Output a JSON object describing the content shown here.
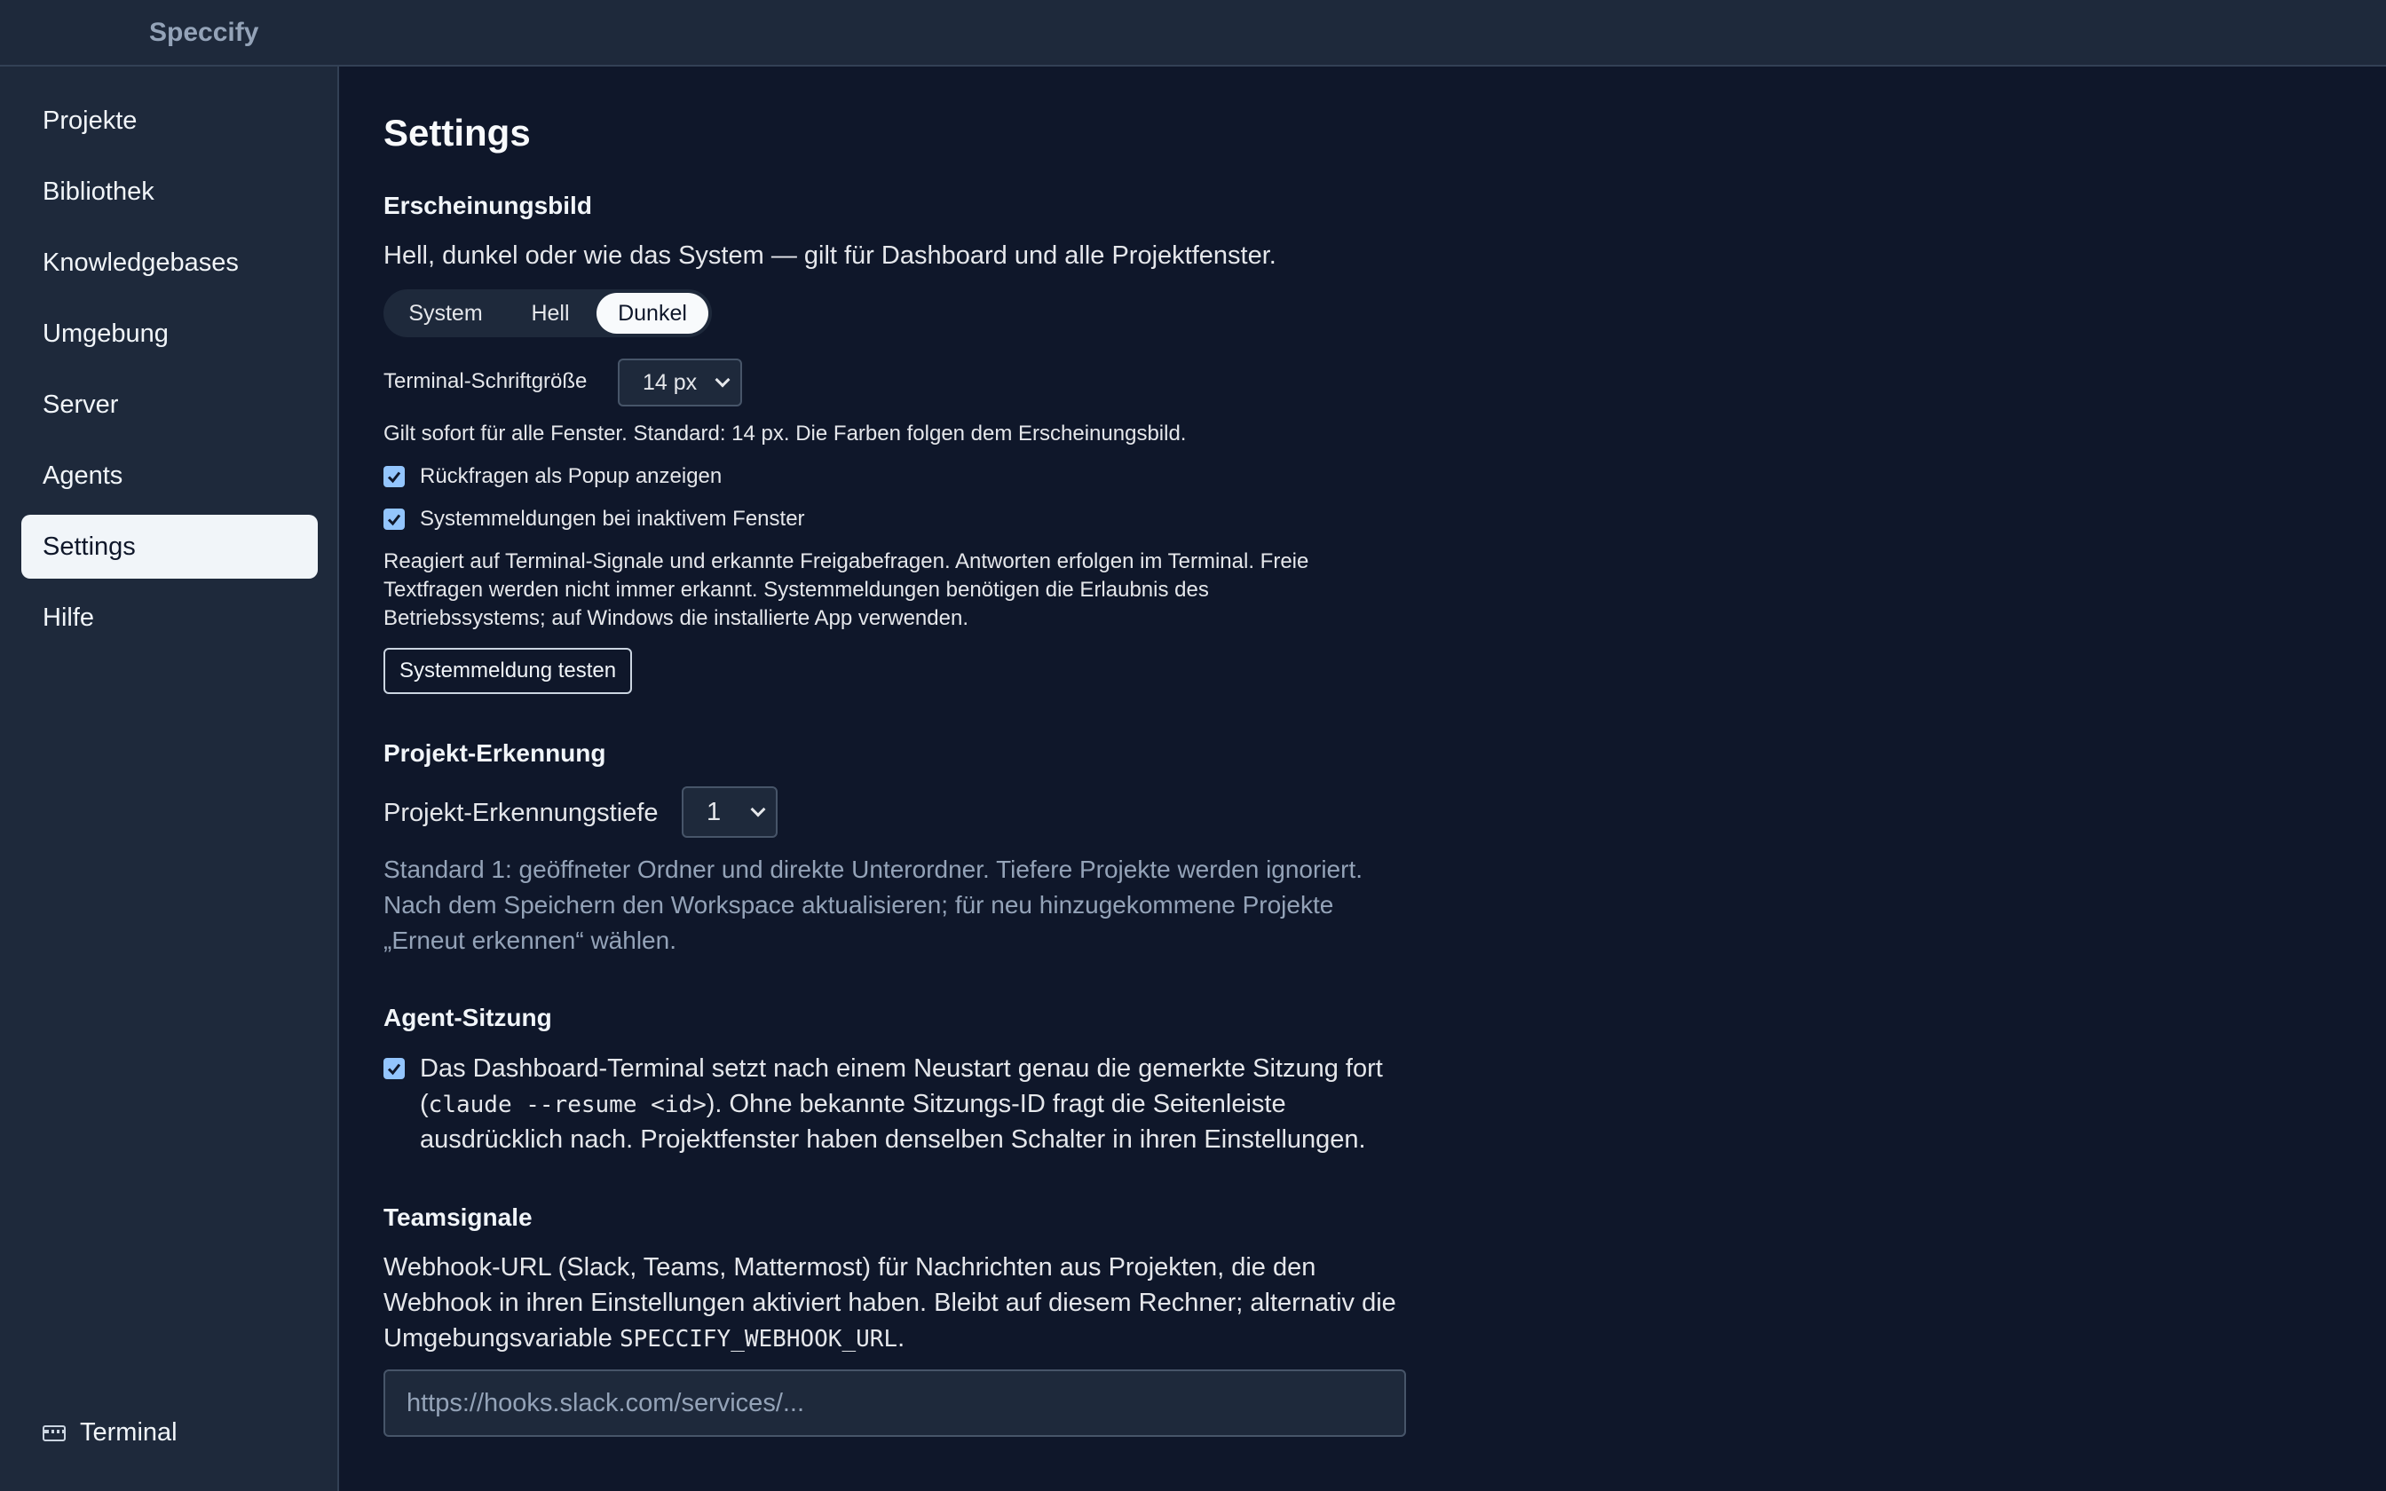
{
  "app": {
    "title": "Speccify"
  },
  "sidebar": {
    "items": [
      {
        "label": "Projekte"
      },
      {
        "label": "Bibliothek"
      },
      {
        "label": "Knowledgebases"
      },
      {
        "label": "Umgebung"
      },
      {
        "label": "Server"
      },
      {
        "label": "Agents"
      },
      {
        "label": "Settings",
        "active": true
      },
      {
        "label": "Hilfe"
      }
    ],
    "footer": {
      "label": "Terminal",
      "icon": "keyboard-icon"
    }
  },
  "page": {
    "title": "Settings"
  },
  "appearance": {
    "heading": "Erscheinungsbild",
    "description": "Hell, dunkel oder wie das System — gilt für Dashboard und alle Projektfenster.",
    "modes": [
      "System",
      "Hell",
      "Dunkel"
    ],
    "selected_mode": "Dunkel",
    "font_size_label": "Terminal-Schriftgröße",
    "font_size_value": "14 px",
    "font_size_hint": "Gilt sofort für alle Fenster. Standard: 14 px. Die Farben folgen dem Erscheinungsbild.",
    "popup_checkbox_label": "Rückfragen als Popup anzeigen",
    "popup_checked": true,
    "system_notify_label": "Systemmeldungen bei inaktivem Fenster",
    "system_notify_checked": true,
    "notify_hint_lines": [
      "Reagiert auf Terminal-Signale und erkannte Freigabefragen. Antworten erfolgen im Terminal. Freie",
      "Textfragen werden nicht immer erkannt. Systemmeldungen benötigen die Erlaubnis des",
      "Betriebssystems; auf Windows die installierte App verwenden."
    ],
    "test_button": "Systemmeldung testen"
  },
  "project_detection": {
    "heading": "Projekt-Erkennung",
    "depth_label": "Projekt-Erkennungstiefe",
    "depth_value": "1",
    "hint_lines": [
      "Standard 1: geöffneter Ordner und direkte Unterordner. Tiefere Projekte werden ignoriert.",
      "Nach dem Speichern den Workspace aktualisieren; für neu hinzugekommene Projekte",
      "„Erneut erkennen“ wählen."
    ]
  },
  "agent_session": {
    "heading": "Agent-Sitzung",
    "checked": true,
    "line1": "Das Dashboard-Terminal setzt nach einem Neustart genau die gemerkte Sitzung fort",
    "line2_prefix": "(",
    "line2_code": "claude --resume <id>",
    "line2_suffix": "). Ohne bekannte Sitzungs-ID fragt die Seitenleiste",
    "line3": "ausdrücklich nach. Projektfenster haben denselben Schalter in ihren Einstellungen."
  },
  "team_signals": {
    "heading": "Teamsignale",
    "line1": "Webhook-URL (Slack, Teams, Mattermost) für Nachrichten aus Projekten, die den",
    "line2": "Webhook in ihren Einstellungen aktiviert haben. Bleibt auf diesem Rechner; alternativ die",
    "line3_prefix": "Umgebungsvariable ",
    "line3_code": "SPECCIFY_WEBHOOK_URL",
    "line3_suffix": ".",
    "placeholder": "https://hooks.slack.com/services/..."
  }
}
